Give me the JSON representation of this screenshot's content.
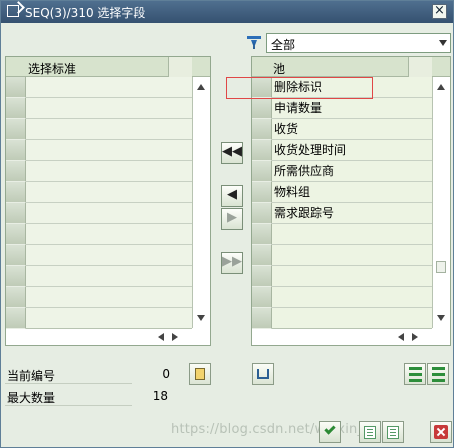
{
  "window": {
    "title": "SEQ(3)/310 选择字段"
  },
  "filter": {
    "selected": "全部"
  },
  "left_table": {
    "header": "选择标准"
  },
  "right_table": {
    "header": "池",
    "rows": [
      "删除标识",
      "申请数量",
      "收货",
      "收货处理时间",
      "所需供应商",
      "物料组",
      "需求跟踪号"
    ]
  },
  "middle_buttons": {
    "move_all_left": "◀◀",
    "move_left": "◀",
    "move_right": "▶",
    "move_all_right": "▶▶"
  },
  "stats": {
    "current_number_label": "当前编号",
    "current_number_value": "0",
    "max_count_label": "最大数量",
    "max_count_value": "18"
  },
  "watermark": "https://blog.csdn.net/weixin_4...3"
}
